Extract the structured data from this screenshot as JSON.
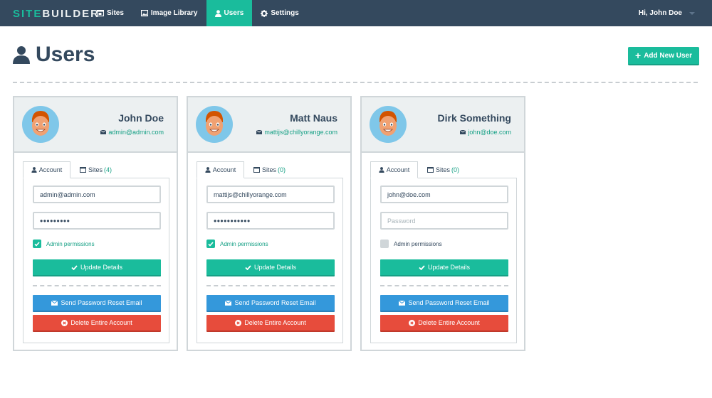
{
  "brand": {
    "part1": "SITE",
    "part2": "BUILDER"
  },
  "nav": [
    {
      "label": "Sites",
      "icon": "sites-icon"
    },
    {
      "label": "Image Library",
      "icon": "image-icon"
    },
    {
      "label": "Users",
      "icon": "user-icon",
      "active": true
    },
    {
      "label": "Settings",
      "icon": "gear-icon"
    }
  ],
  "user_menu": {
    "label": "Hi, John Doe"
  },
  "page": {
    "title": "Users",
    "add_button": "Add New User"
  },
  "colors": {
    "nav_bg": "#34495e",
    "accent": "#1abc9c",
    "blue": "#3498db",
    "red": "#e74c3c"
  },
  "cards": [
    {
      "name": "John Doe",
      "email": "admin@admin.com",
      "tab_account": "Account",
      "tab_sites": "Sites",
      "sites_count": "(4)",
      "email_value": "admin@admin.com",
      "password_value": "•••••••••",
      "admin_label": "Admin permissions",
      "admin": true,
      "update_label": "Update Details",
      "reset_label": "Send Password Reset Email",
      "delete_label": "Delete Entire Account"
    },
    {
      "name": "Matt Naus",
      "email": "mattijs@chillyorange.com",
      "tab_account": "Account",
      "tab_sites": "Sites",
      "sites_count": "(0)",
      "email_value": "mattijs@chillyorange.com",
      "password_value": "•••••••••••",
      "admin_label": "Admin permissions",
      "admin": true,
      "update_label": "Update Details",
      "reset_label": "Send Password Reset Email",
      "delete_label": "Delete Entire Account"
    },
    {
      "name": "Dirk Something",
      "email": "john@doe.com",
      "tab_account": "Account",
      "tab_sites": "Sites",
      "sites_count": "(0)",
      "email_value": "john@doe.com",
      "password_placeholder": "Password",
      "admin_label": "Admin permissions",
      "admin": false,
      "update_label": "Update Details",
      "reset_label": "Send Password Reset Email",
      "delete_label": "Delete Entire Account"
    }
  ]
}
